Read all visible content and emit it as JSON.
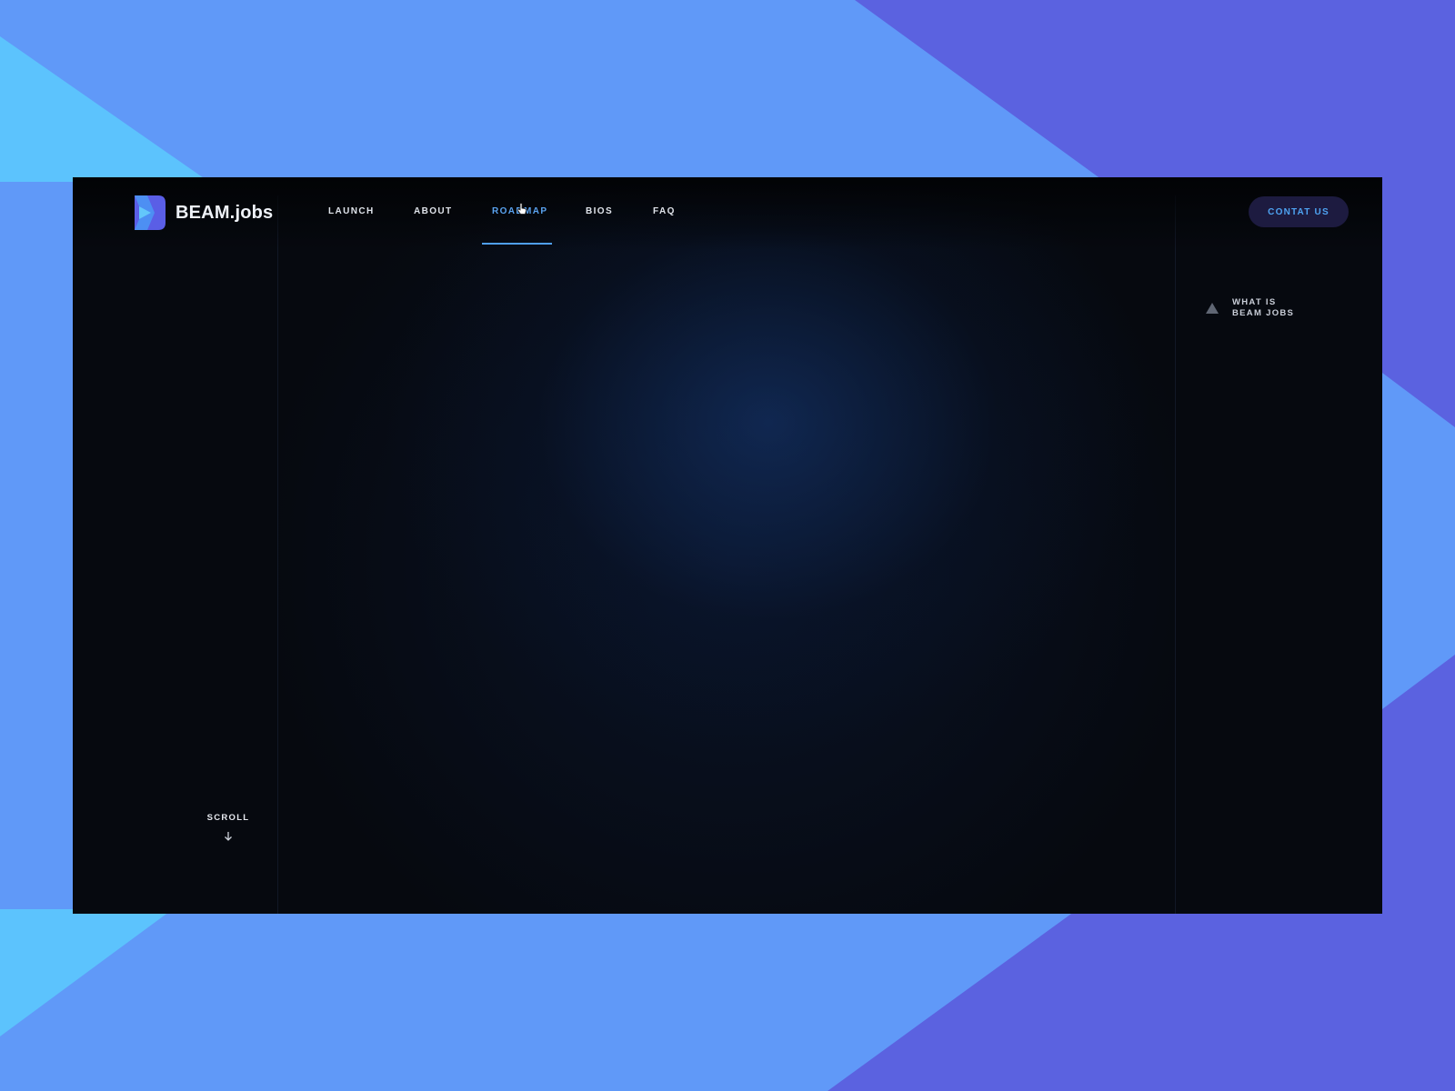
{
  "brand": {
    "name": "BEAM.jobs",
    "logo_icon": "beam-logo-icon"
  },
  "nav": {
    "items": [
      {
        "label": "LAUNCH",
        "active": false
      },
      {
        "label": "ABOUT",
        "active": false
      },
      {
        "label": "ROADMAP",
        "active": true
      },
      {
        "label": "BIOS",
        "active": false
      },
      {
        "label": "FAQ",
        "active": false
      }
    ]
  },
  "header": {
    "contact_label": "CONTAT US"
  },
  "sidebar": {
    "link_line1": "WHAT IS",
    "link_line2": "BEAM JOBS",
    "link_icon": "triangle-up-icon"
  },
  "scroll": {
    "label": "SCROLL",
    "icon": "arrow-down-icon"
  },
  "colors": {
    "backdrop": "#6099f8",
    "backdrop_light": "#5cc3fd",
    "backdrop_dark": "#5b62e0",
    "window_bg": "#06090f",
    "accent": "#4ea3f2",
    "button_bg": "#1d1b40"
  }
}
